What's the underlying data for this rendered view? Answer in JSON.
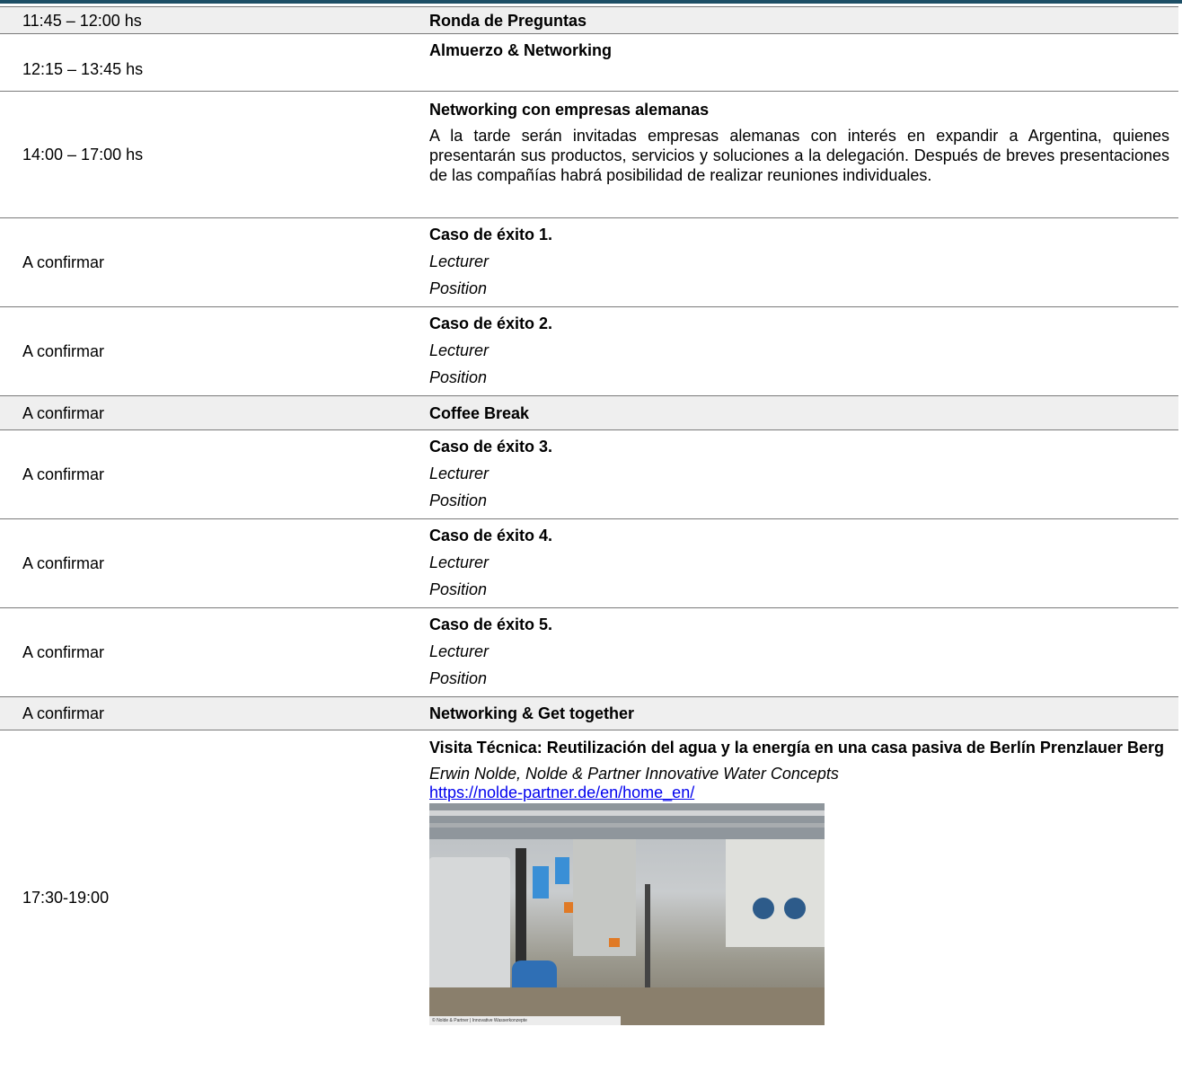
{
  "rows": [
    {
      "time": "11:45 – 12:00 hs",
      "title": "Ronda de Preguntas"
    },
    {
      "time": "12:15 – 13:45 hs",
      "title": "Almuerzo & Networking"
    },
    {
      "time": "14:00 – 17:00 hs",
      "title": "Networking con empresas alemanas",
      "body": "A la tarde serán invitadas empresas alemanas con interés en expandir a Argentina, quienes presentarán sus productos, servicios y soluciones a la delegación. Después de breves presentaciones de las compañías habrá posibilidad de realizar reuniones individuales."
    },
    {
      "time": "A confirmar",
      "title": "Caso de éxito 1.",
      "lecturer": "Lecturer",
      "position": "Position"
    },
    {
      "time": "A confirmar",
      "title": "Caso de éxito 2.",
      "lecturer": "Lecturer",
      "position": "Position"
    },
    {
      "time": "A confirmar",
      "title": "Coffee Break"
    },
    {
      "time": "A confirmar",
      "title": "Caso de éxito 3.",
      "lecturer": "Lecturer",
      "position": "Position"
    },
    {
      "time": "A confirmar",
      "title": "Caso de éxito 4.",
      "lecturer": "Lecturer",
      "position": "Position"
    },
    {
      "time": "A confirmar",
      "title": "Caso de éxito 5.",
      "lecturer": "Lecturer",
      "position": "Position"
    },
    {
      "time": "A confirmar",
      "title": "Networking & Get together"
    },
    {
      "time": "17:30-19:00",
      "title": "Visita Técnica: Reutilización del agua y la energía en una casa pasiva de Berlín Prenzlauer Berg",
      "host": "Erwin Nolde, Nolde & Partner Innovative Water Concepts",
      "link": "https://nolde-partner.de/en/home_en/",
      "photo_caption": "© Nolde & Partner | Innovative Wasserkonzepte"
    }
  ],
  "colors": {
    "top_rule": "#1d4f66",
    "shaded_row": "#efefef",
    "link": "#0000ee"
  }
}
